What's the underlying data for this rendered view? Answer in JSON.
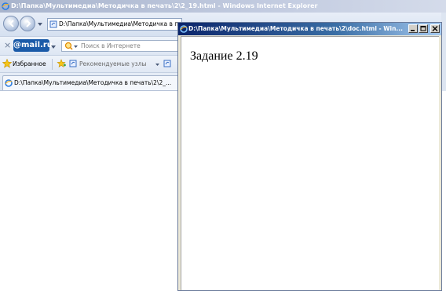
{
  "background_window": {
    "title": "D:\\Папка\\Мультимедиа\\Методичка в печать\\2\\2_19.html - Windows Internet Explorer",
    "address": "D:\\Папка\\Мультимедиа\\Методичка в печать\\2\\2_19.html",
    "search_placeholder": "Поиск в Интернете",
    "mail_logo": "@mail.ru",
    "close_glyph": "×",
    "favorites_label": "Избранное",
    "recommended_label": "Рекомендуемые узлы",
    "tab_title": "D:\\Папка\\Мультимедиа\\Методичка в печать\\2\\2_..."
  },
  "popup_window": {
    "title": "D:\\Папка\\Мультимедиа\\Методичка в печать\\2\\doc.html - Win...",
    "heading": "Задание 2.19"
  },
  "icons": {
    "ie": "ie-logo-icon",
    "back": "back-arrow-icon",
    "forward": "forward-arrow-icon",
    "search": "search-icon",
    "favorites": "favorites-star-icon",
    "add_favorites": "add-favorites-icon",
    "page": "page-icon"
  },
  "colors": {
    "popup_title_start": "#0a246a",
    "popup_title_end": "#a6caf0",
    "mailru_blue": "#1a5aa8",
    "mailru_orange": "#ff9f1a"
  }
}
